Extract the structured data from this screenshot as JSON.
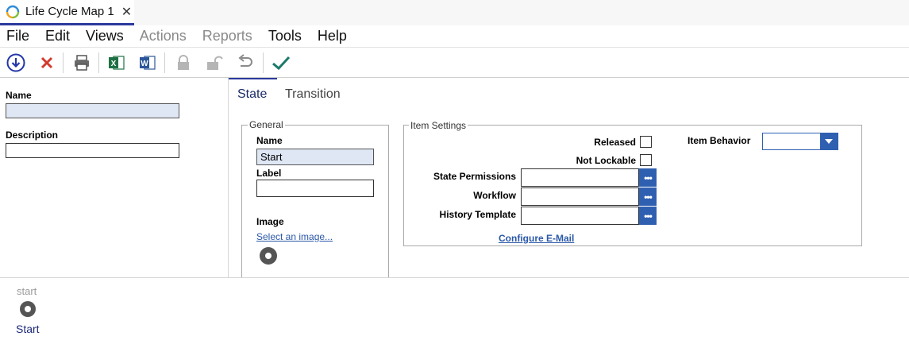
{
  "document_tab": {
    "title": "Life Cycle Map 1",
    "close_glyph": "✕"
  },
  "menu": [
    {
      "label": "File",
      "enabled": true
    },
    {
      "label": "Edit",
      "enabled": true
    },
    {
      "label": "Views",
      "enabled": true
    },
    {
      "label": "Actions",
      "enabled": false
    },
    {
      "label": "Reports",
      "enabled": false
    },
    {
      "label": "Tools",
      "enabled": true
    },
    {
      "label": "Help",
      "enabled": true
    }
  ],
  "toolbar": {
    "icons": [
      "save-icon",
      "discard-icon",
      "print-icon",
      "excel-icon",
      "word-icon",
      "lock-icon",
      "unlock-icon",
      "undo-icon",
      "done-icon"
    ]
  },
  "left_panel": {
    "name_label": "Name",
    "name_value": "",
    "description_label": "Description",
    "description_value": ""
  },
  "tabs": [
    {
      "label": "State",
      "active": true
    },
    {
      "label": "Transition",
      "active": false
    }
  ],
  "general": {
    "title": "General",
    "name_label": "Name",
    "name_value": "Start",
    "label_label": "Label",
    "label_value": "",
    "image_label": "Image",
    "select_image_link": "Select an image..."
  },
  "item_settings": {
    "title": "Item Settings",
    "released_label": "Released",
    "released_checked": false,
    "not_lockable_label": "Not Lockable",
    "not_lockable_checked": false,
    "item_behavior_label": "Item Behavior",
    "item_behavior_value": "",
    "state_permissions_label": "State Permissions",
    "state_permissions_value": "",
    "workflow_label": "Workflow",
    "workflow_value": "",
    "history_template_label": "History Template",
    "history_template_value": "",
    "ellipsis": "•••",
    "configure_email_link": "Configure E-Mail"
  },
  "diagram": {
    "node_caption": "start",
    "node_label": "Start"
  },
  "colors": {
    "accent": "#2b3a9e",
    "button_blue": "#2f5fb0",
    "field_blue": "#dfe7f5",
    "link": "#2b58a8"
  }
}
